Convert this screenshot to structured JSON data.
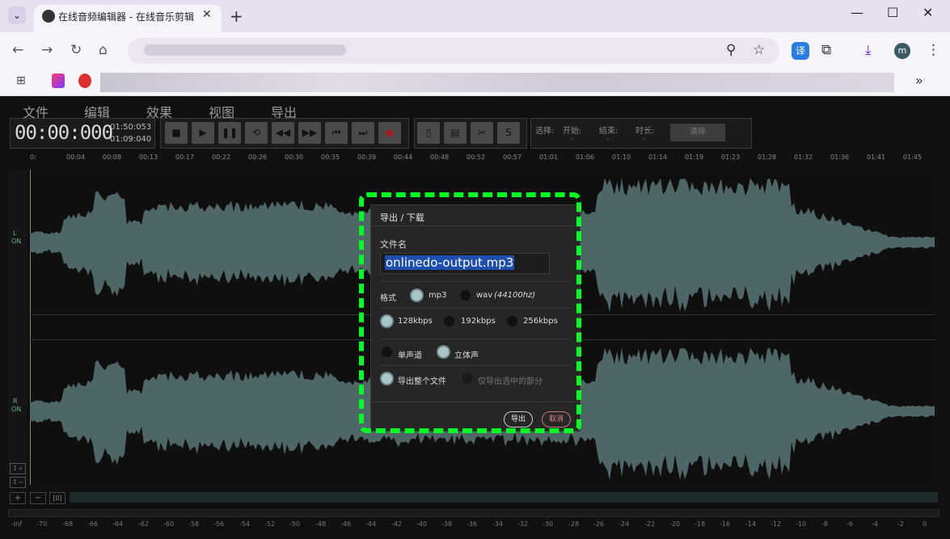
{
  "browser": {
    "tab_title": "在线音频编辑器 - 在线音乐剪辑",
    "tab_close": "✕",
    "new_tab": "+",
    "menu_chevron": "⌄",
    "win_min": "—",
    "win_max": "☐",
    "win_close": "✕",
    "nav_icons": [
      "back-icon",
      "forward-icon",
      "reload-icon",
      "home-icon"
    ],
    "more_bookmarks": "»",
    "profile_initial": "m",
    "translate_badge": "译"
  },
  "app": {
    "menu": [
      "文件",
      "编辑",
      "效果",
      "视图",
      "导出"
    ],
    "time_main": "00:00:000",
    "time_total": "01:50:053",
    "time_sel": "01:09:040",
    "selection": {
      "label": "选择:",
      "start_label": "开始:",
      "end_label": "结束:",
      "duration_label": "时长:",
      "start_value": "-",
      "end_value": "-",
      "duration_value": "-",
      "clear_label": "清除"
    },
    "ruler_ticks": [
      "0:",
      "00:04",
      "00:08",
      "00:13",
      "00:17",
      "00:22",
      "00:26",
      "00:30",
      "00:35",
      "00:39",
      "00:44",
      "00:48",
      "00:52",
      "00:57",
      "01:01",
      "01:06",
      "01:10",
      "01:14",
      "01:19",
      "01:23",
      "01:28",
      "01:32",
      "01:36",
      "01:41",
      "01:45"
    ],
    "channels": {
      "left_label": "L",
      "left_state": "ON",
      "right_label": "R",
      "right_state": "ON"
    },
    "zoom_buttons": [
      "+",
      "−",
      "[0]"
    ],
    "db_labels": [
      "-Inf",
      "-70",
      "-68",
      "-66",
      "-64",
      "-62",
      "-60",
      "-58",
      "-56",
      "-54",
      "-52",
      "-50",
      "-48",
      "-46",
      "-44",
      "-42",
      "-40",
      "-38",
      "-36",
      "-34",
      "-32",
      "-30",
      "-28",
      "-26",
      "-24",
      "-22",
      "-20",
      "-18",
      "-16",
      "-14",
      "-12",
      "-10",
      "-8",
      "-6",
      "-4",
      "-2",
      "0"
    ],
    "toolbar_s": "S"
  },
  "dialog": {
    "title": "导出 / 下载",
    "filename_label": "文件名",
    "filename_value": "onlinedo-output.mp3",
    "format_label": "格式",
    "formats": [
      {
        "label": "mp3",
        "checked": true
      },
      {
        "label": "wav",
        "extra": "(44100hz)",
        "checked": false
      }
    ],
    "bitrates": [
      {
        "label": "128kbps",
        "checked": true
      },
      {
        "label": "192kbps",
        "checked": false
      },
      {
        "label": "256kbps",
        "checked": false
      }
    ],
    "channels": [
      {
        "label": "单声道",
        "checked": false
      },
      {
        "label": "立体声",
        "checked": true
      }
    ],
    "range": [
      {
        "label": "导出整个文件",
        "checked": true
      },
      {
        "label": "仅导出选中的部分",
        "checked": false
      }
    ],
    "export_label": "导出",
    "cancel_label": "取消"
  },
  "colors": {
    "waveform": "#4f6666",
    "highlight": "#00ff22",
    "dialog_bg": "#262626"
  }
}
